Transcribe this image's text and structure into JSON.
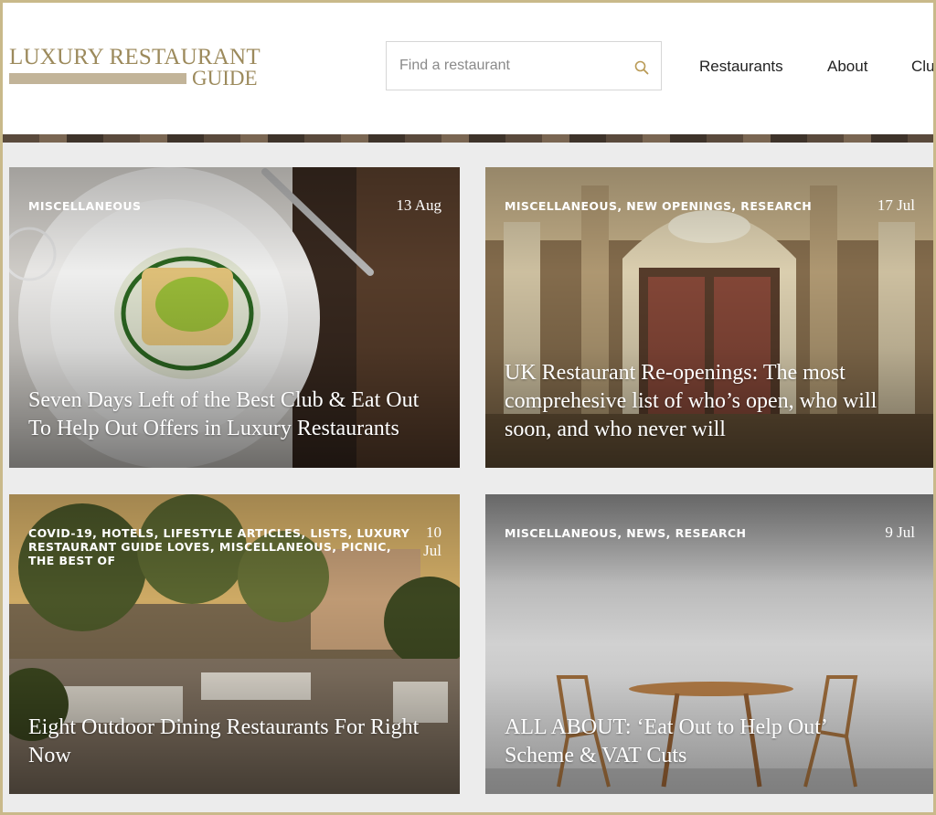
{
  "header": {
    "logo": {
      "line1": "LUXURY RESTAURANT",
      "line2": "GUIDE"
    },
    "search": {
      "placeholder": "Find a restaurant",
      "icon": "search-icon"
    },
    "nav": [
      "Restaurants",
      "About",
      "Clu"
    ]
  },
  "colors": {
    "brand_gold": "#9c8a5c",
    "frame": "#c9b98a"
  },
  "articles": [
    {
      "categories": "MISCELLANEOUS",
      "date": "13 Aug",
      "title": "Seven Days Left of the Best Club & Eat Out To Help Out Offers in Luxury Restaurants"
    },
    {
      "categories": "MISCELLANEOUS, NEW OPENINGS, RESEARCH",
      "date": "17 Jul",
      "title": "UK Restaurant Re-openings: The most comprehesive list of who’s open, who will soon, and who never will"
    },
    {
      "categories": "COVID-19, HOTELS, LIFESTYLE ARTICLES, LISTS, LUXURY RESTAURANT GUIDE LOVES, MISCELLANEOUS, PICNIC, THE BEST OF",
      "date": "10 Jul",
      "title": "Eight Outdoor Dining Restaurants For Right Now"
    },
    {
      "categories": "MISCELLANEOUS, NEWS, RESEARCH",
      "date": "9 Jul",
      "title": "ALL ABOUT: ‘Eat Out to Help Out’ Scheme & VAT Cuts"
    }
  ]
}
